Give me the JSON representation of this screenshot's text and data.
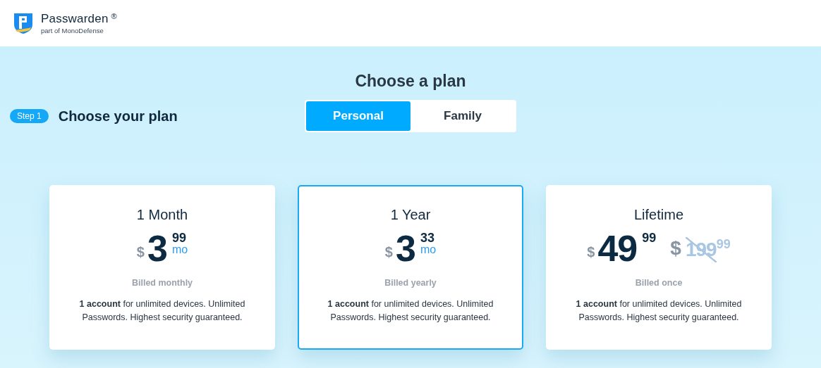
{
  "header": {
    "brand": "Passwarden",
    "registered": "®",
    "tagline": "part of MonoDefense"
  },
  "title": "Choose a plan",
  "step": {
    "badge": "Step 1",
    "label": "Choose your plan"
  },
  "plan_types": [
    {
      "label": "Personal",
      "selected": true
    },
    {
      "label": "Family",
      "selected": false
    }
  ],
  "plans": [
    {
      "name": "1 Month",
      "selected": false,
      "currency": "$",
      "amount": "3",
      "cents": "99",
      "period": "mo",
      "billing": "Billed monthly",
      "description": "**1 account** for unlimited devices. Unlimited Passwords. Highest security guaranteed."
    },
    {
      "name": "1 Year",
      "selected": true,
      "currency": "$",
      "amount": "3",
      "cents": "33",
      "period": "mo",
      "billing": "Billed yearly",
      "description": "**1 account** for unlimited devices. Unlimited Passwords. Highest security guaranteed."
    },
    {
      "name": "Lifetime",
      "selected": false,
      "currency": "$",
      "amount": "49",
      "cents": "99",
      "old_price": {
        "currency": "$",
        "amount": "199",
        "cents": "99"
      },
      "billing": "Billed once",
      "description": "**1 account** for unlimited devices. Unlimited Passwords. Highest security guaranteed."
    }
  ]
}
